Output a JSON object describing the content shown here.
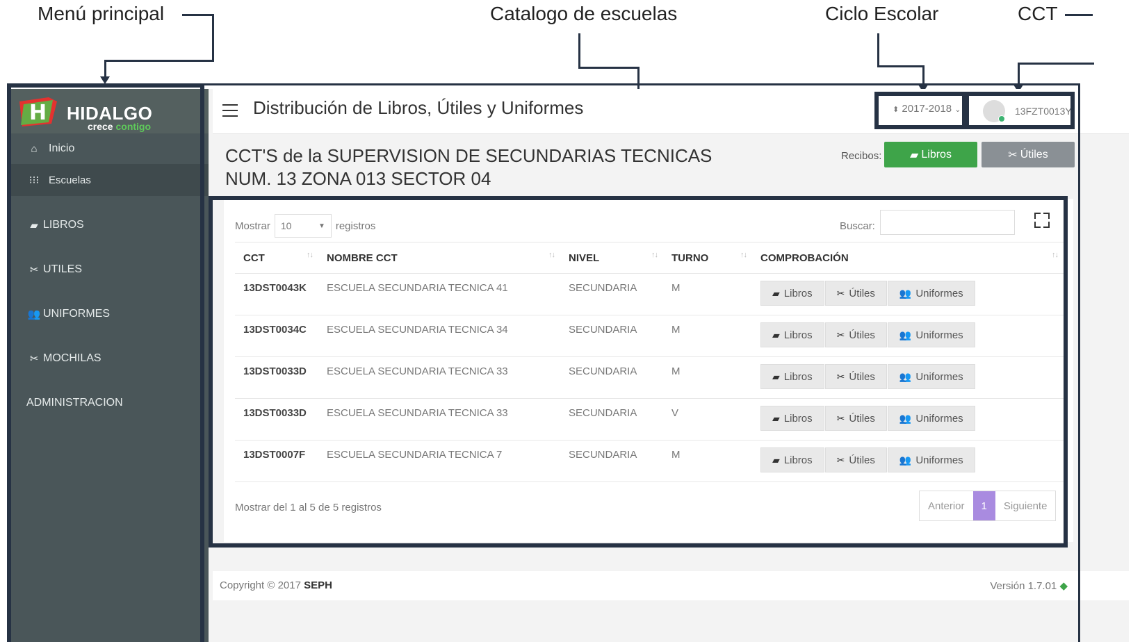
{
  "annotations": {
    "menu": "Menú principal",
    "catalog": "Catalogo de escuelas",
    "cycle": "Ciclo Escolar",
    "cct": "CCT"
  },
  "sidebar": {
    "brand": "HIDALGO",
    "brand_sub_a": "crece ",
    "brand_sub_b": "contigo",
    "items": [
      {
        "icon": "home-icon",
        "label": "Inicio"
      },
      {
        "icon": "grid-icon",
        "label": "Escuelas"
      },
      {
        "icon": "book-icon",
        "label": "LIBROS"
      },
      {
        "icon": "scissors-icon",
        "label": "UTILES"
      },
      {
        "icon": "users-icon",
        "label": "UNIFORMES"
      },
      {
        "icon": "scissors-icon",
        "label": "MOCHILAS"
      },
      {
        "icon": "",
        "label": "ADMINISTRACION"
      }
    ]
  },
  "header": {
    "title": "Distribución de Libros, Útiles y Uniformes",
    "cycle": "2017-2018",
    "user_cct": "13FZT0013Y"
  },
  "page": {
    "title_line1": "CCT'S de la SUPERVISION DE SECUNDARIAS TECNICAS",
    "title_line2": "NUM. 13 ZONA 013 SECTOR 04",
    "recibos_label": "Recibos:",
    "btn_libros": "Libros",
    "btn_utiles": "Útiles"
  },
  "table": {
    "show_label": "Mostrar",
    "show_value": "10",
    "records_label": "registros",
    "search_label": "Buscar:",
    "columns": [
      "CCT",
      "NOMBRE CCT",
      "NIVEL",
      "TURNO",
      "COMPROBACIÓN"
    ],
    "rows": [
      {
        "cct": "13DST0043K",
        "nombre": "ESCUELA SECUNDARIA TECNICA 41",
        "nivel": "SECUNDARIA",
        "turno": "M"
      },
      {
        "cct": "13DST0034C",
        "nombre": "ESCUELA SECUNDARIA TECNICA 34",
        "nivel": "SECUNDARIA",
        "turno": "M"
      },
      {
        "cct": "13DST0033D",
        "nombre": "ESCUELA SECUNDARIA TECNICA 33",
        "nivel": "SECUNDARIA",
        "turno": "M"
      },
      {
        "cct": "13DST0033D",
        "nombre": "ESCUELA SECUNDARIA TECNICA 33",
        "nivel": "SECUNDARIA",
        "turno": "V"
      },
      {
        "cct": "13DST0007F",
        "nombre": "ESCUELA SECUNDARIA TECNICA 7",
        "nivel": "SECUNDARIA",
        "turno": "M"
      }
    ],
    "action_labels": [
      "Libros",
      "Útiles",
      "Uniformes"
    ],
    "info": "Mostrar del 1 al 5 de 5 registros",
    "prev": "Anterior",
    "current_page": "1",
    "next": "Siguiente"
  },
  "footer": {
    "copyright": "Copyright © 2017 ",
    "org": "SEPH",
    "version": "Versión 1.7.01"
  },
  "colors": {
    "accent_green": "#3ea449",
    "pager_active": "#a98be0",
    "sidebar_bg": "#4a5659"
  }
}
